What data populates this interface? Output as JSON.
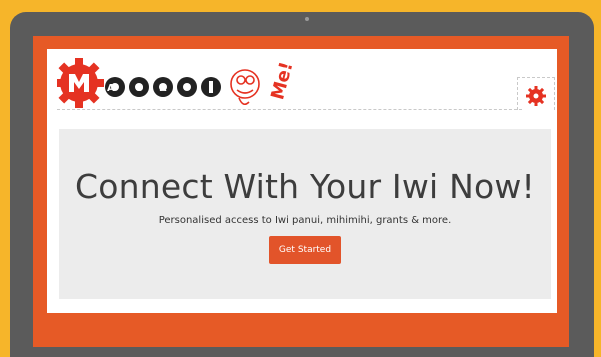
{
  "brand": {
    "logo_text": "MAORI Me!"
  },
  "hero": {
    "headline": "Connect With Your Iwi Now!",
    "subtitle": "Personalised access to Iwi panui, mihimihi, grants & more.",
    "cta_label": "Get Started"
  },
  "colors": {
    "background": "#f6b52a",
    "bezel": "#5b5b5b",
    "screen_border": "#e65a26",
    "accent": "#e2542a",
    "hero_bg": "#ececec"
  }
}
